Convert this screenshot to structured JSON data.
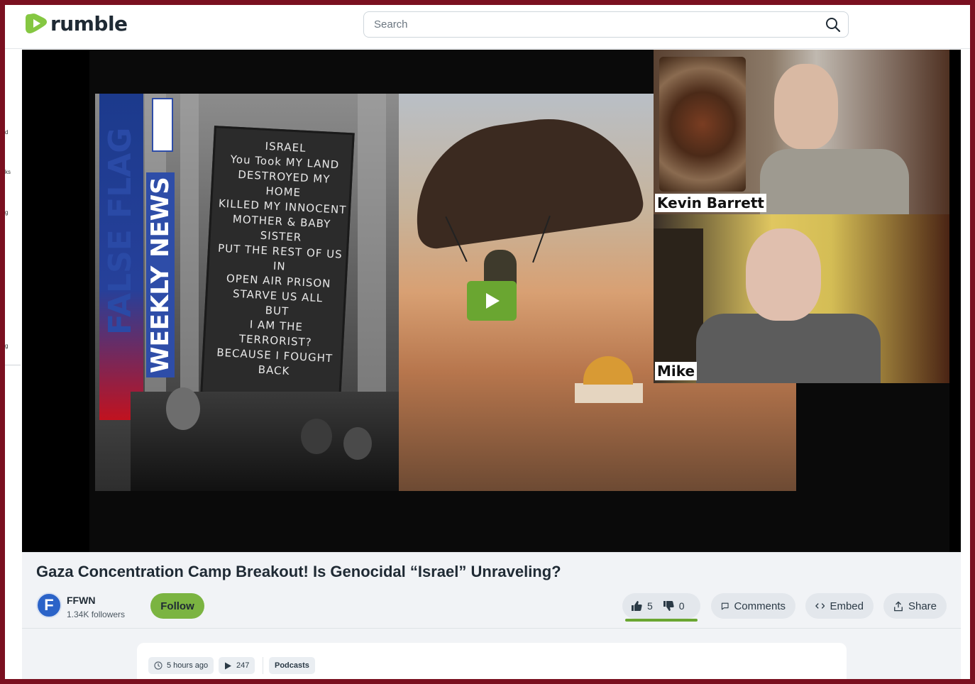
{
  "header": {
    "logo_text": "rumble",
    "search_placeholder": "Search"
  },
  "sidebar": {
    "fragments": [
      "d",
      "ks",
      "g",
      "g"
    ]
  },
  "player": {
    "overlay_texts": {
      "banner_1": "FALSE FLAG",
      "banner_2": "WEEKLY NEWS",
      "sign": "ISRAEL\nYou Took MY LAND\nDESTROYED MY HOME\nKILLED MY INNOCENT\nMOTHER & BABY SISTER\nPUT THE REST OF US IN\nOPEN AIR PRISON\nSTARVE US ALL\nBUT\nI AM THE TERRORIST?\nBECAUSE I FOUGHT\nBACK",
      "speaker_1": "Kevin Barrett",
      "speaker_2": "Mike"
    },
    "play_icon": "play-icon",
    "pip_icon": "picture-in-picture-icon",
    "brand_color": "#6aa631"
  },
  "video": {
    "title": "Gaza Concentration Camp Breakout! Is Genocidal “Israel” Unraveling?",
    "channel": {
      "avatar_letter": "F",
      "name": "FFWN",
      "followers": "1.34K followers"
    },
    "follow_label": "Follow",
    "likes": "5",
    "dislikes": "0",
    "comments_label": "Comments",
    "embed_label": "Embed",
    "share_label": "Share"
  },
  "details": {
    "time_ago": "5 hours ago",
    "views": "247",
    "category": "Podcasts"
  }
}
